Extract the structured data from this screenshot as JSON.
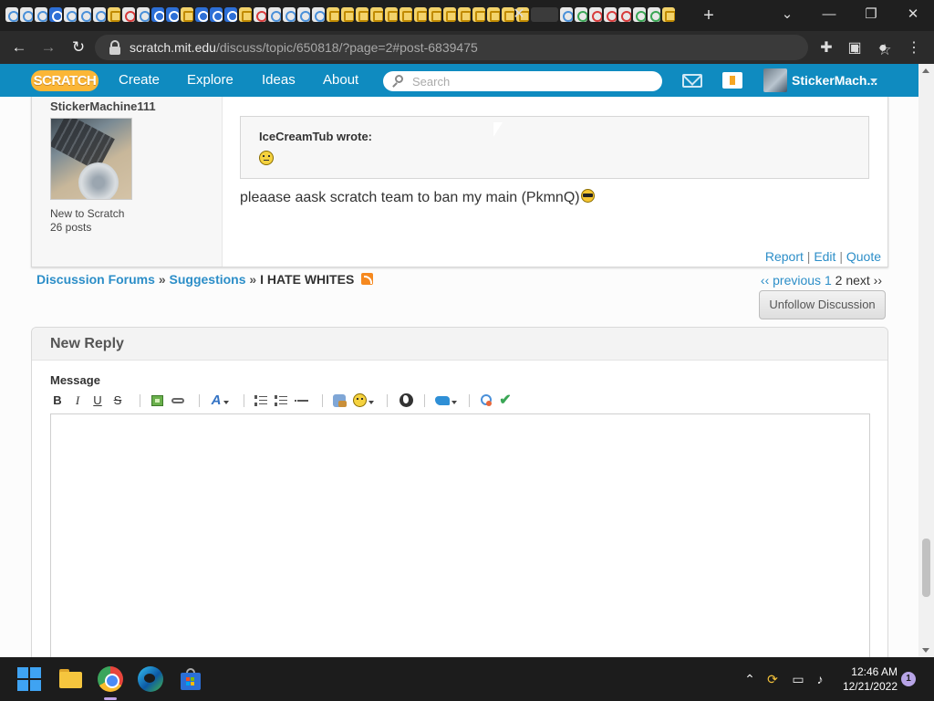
{
  "browser": {
    "url_host": "scratch.mit.edu",
    "url_path": "/discuss/topic/650818/?page=2#post-6839475",
    "tab_close_glyph": "✕",
    "new_tab_glyph": "+",
    "tab_favicon_count": 36
  },
  "scratch_nav": {
    "logo_text": "SCRATCH",
    "links": {
      "create": "Create",
      "explore": "Explore",
      "ideas": "Ideas",
      "about": "About"
    },
    "search_placeholder": "Search",
    "username": "StickerMach...",
    "brand_color": "#0f8bc0"
  },
  "post": {
    "author": "StickerMachine111",
    "author_rank": "New to Scratch",
    "author_posts": "26 posts",
    "quote_author": "IceCreamTub wrote:",
    "quote_emoji": "sad-smiley",
    "body": "pleaase aask scratch team to ban my main (PkmnQ)",
    "body_emoji": "cool-smiley",
    "actions": {
      "report": "Report",
      "edit": "Edit",
      "quote": "Quote",
      "separator": "|"
    }
  },
  "breadcrumb": {
    "forums": "Discussion Forums",
    "separator": "»",
    "category": "Suggestions",
    "topic": "I HATE WHITES"
  },
  "pagination": {
    "previous": "‹‹ previous",
    "page1": "1",
    "current": "2",
    "next": "next ››"
  },
  "unfollow_label": "Unfollow Discussion",
  "reply": {
    "title": "New Reply",
    "message_label": "Message",
    "message_value": "",
    "toolbar": {
      "bold": "B",
      "italic": "I",
      "underline": "U",
      "strike": "S",
      "font": "A"
    }
  },
  "taskbar": {
    "time": "12:46 AM",
    "date": "12/21/2022",
    "notification_count": "1"
  }
}
